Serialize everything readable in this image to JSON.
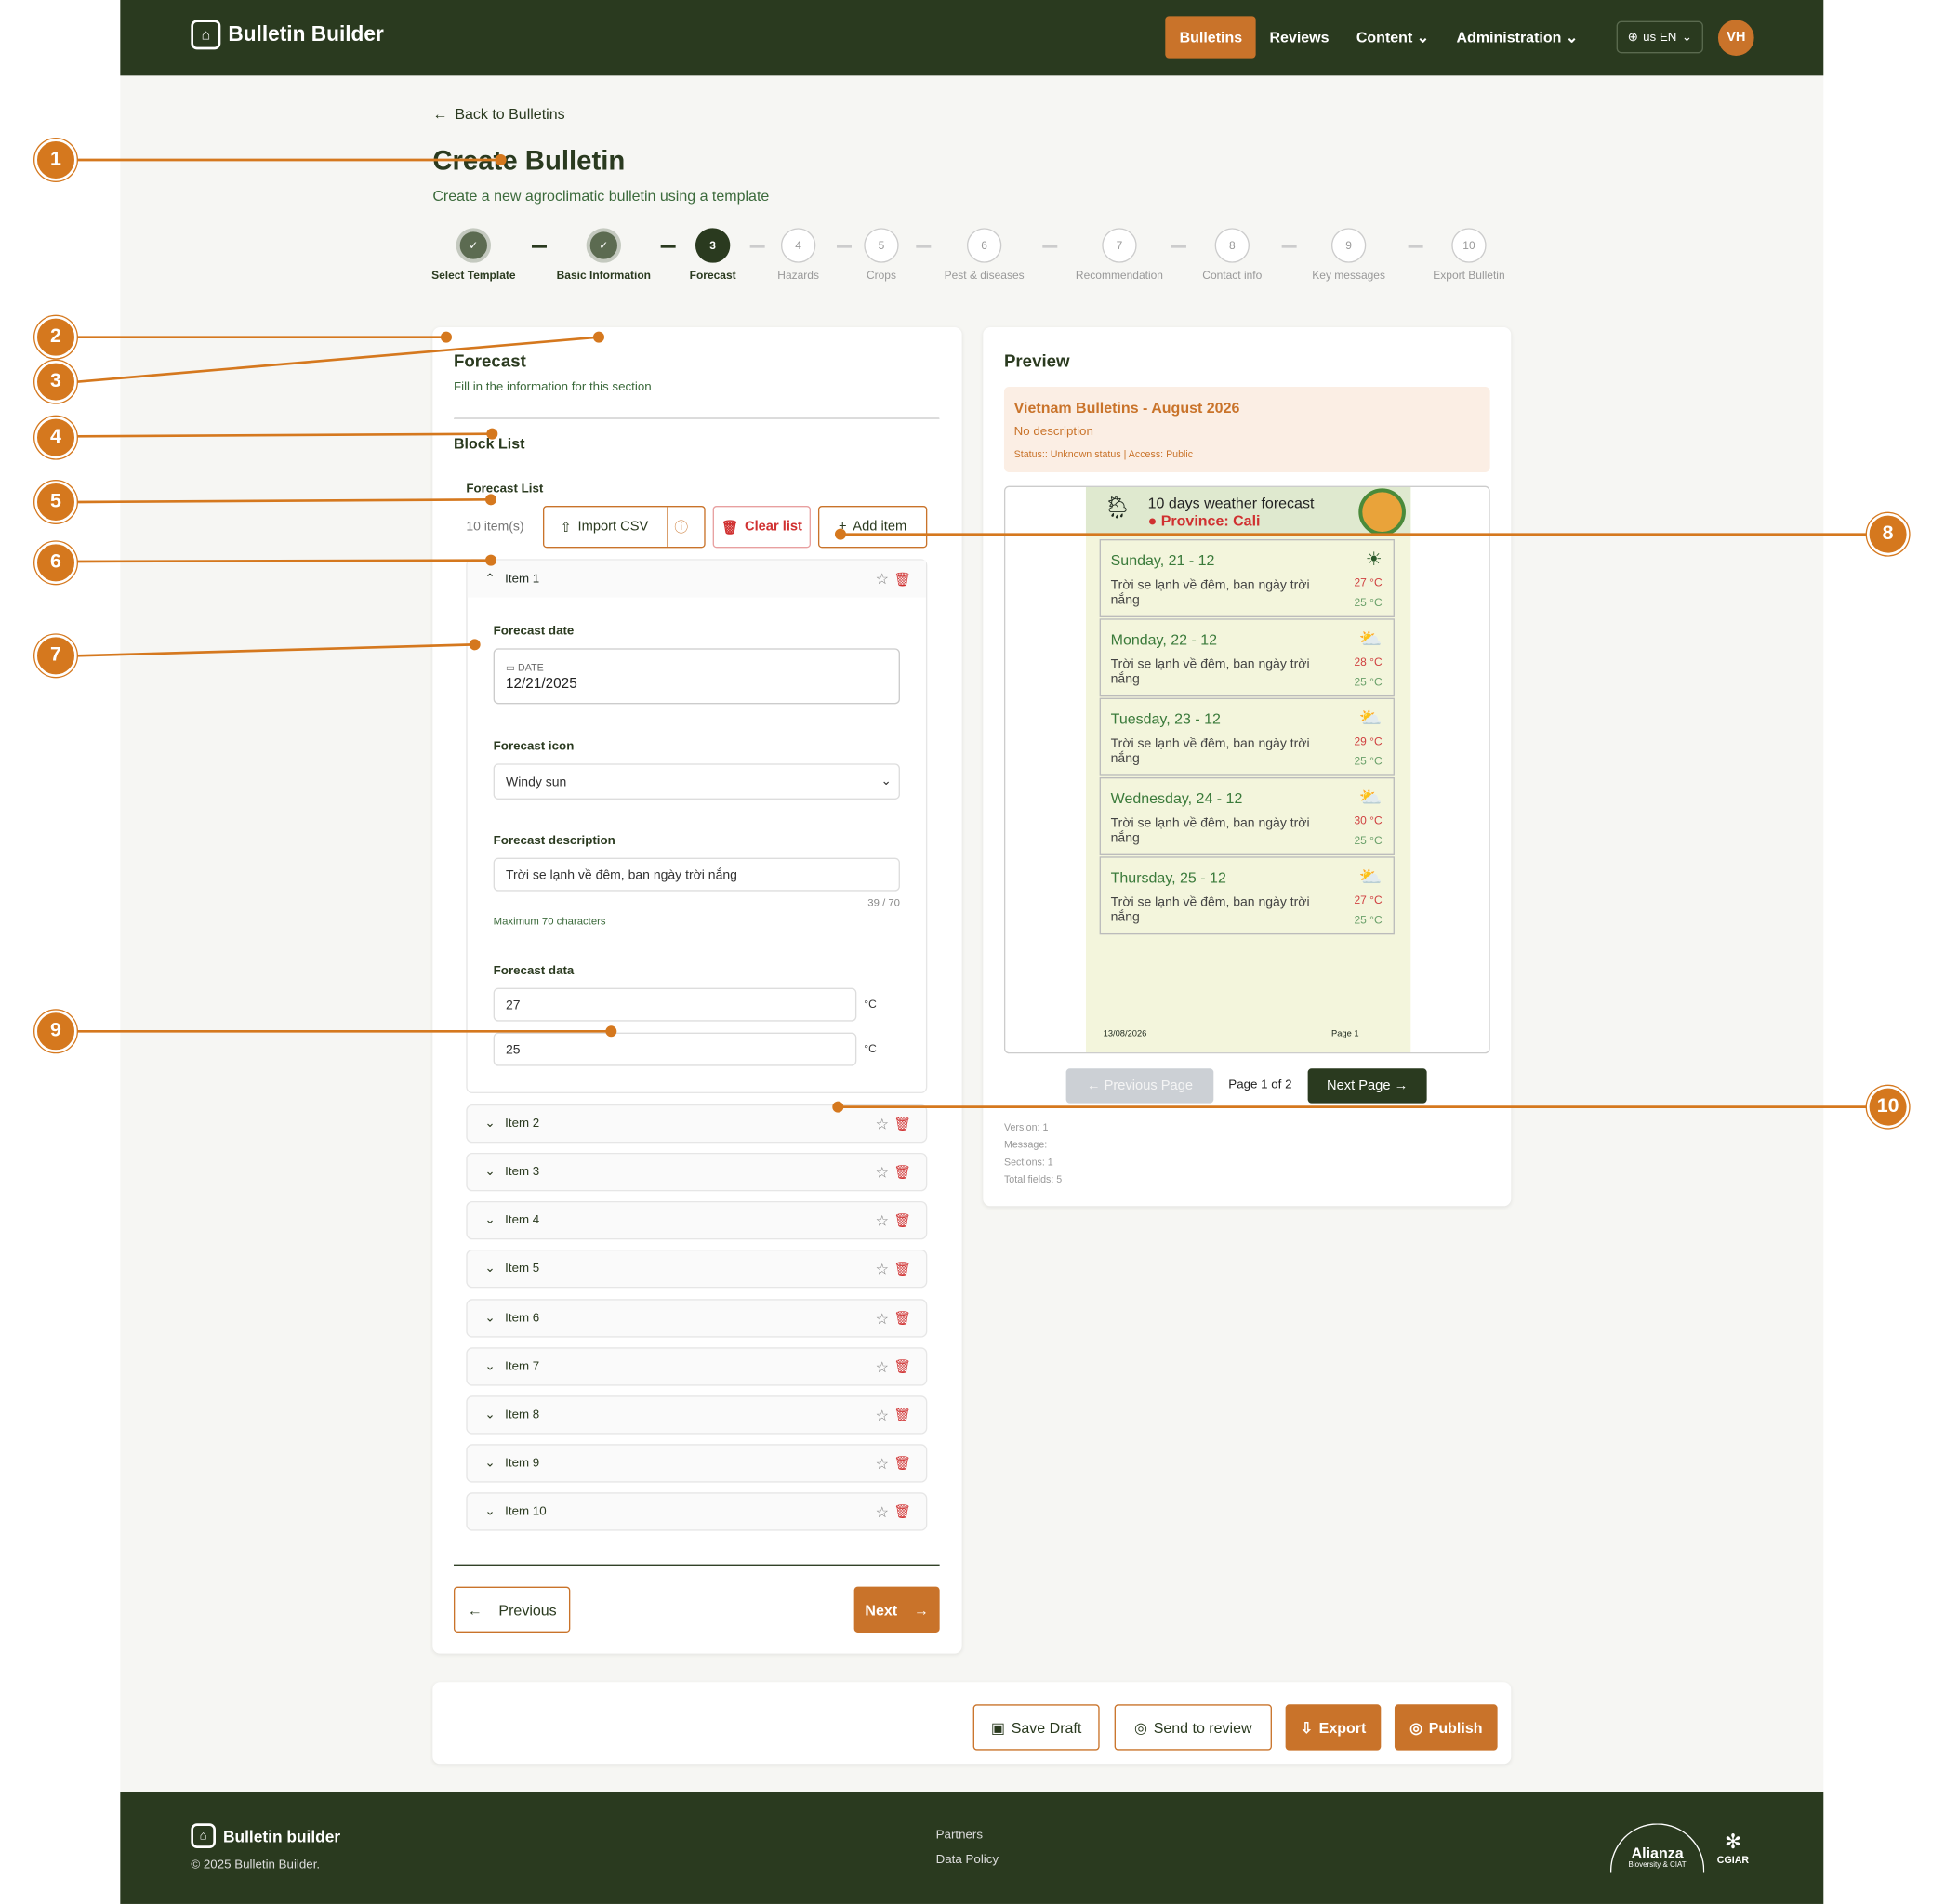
{
  "nav": {
    "brand": "Bulletin Builder",
    "links": [
      "Bulletins",
      "Reviews",
      "Content",
      "Administration"
    ],
    "lang": "us EN",
    "avatar": "VH"
  },
  "header": {
    "back": "Back to Bulletins",
    "title": "Create Bulletin",
    "subtitle": "Create a new agroclimatic bulletin using a template"
  },
  "steps": [
    {
      "num": "",
      "label": "Select Template",
      "state": "done"
    },
    {
      "num": "",
      "label": "Basic Information",
      "state": "done"
    },
    {
      "num": "3",
      "label": "Forecast",
      "state": "current"
    },
    {
      "num": "4",
      "label": "Hazards",
      "state": "todo"
    },
    {
      "num": "5",
      "label": "Crops",
      "state": "todo"
    },
    {
      "num": "6",
      "label": "Pest & diseases",
      "state": "todo"
    },
    {
      "num": "7",
      "label": "Recommendation",
      "state": "todo"
    },
    {
      "num": "8",
      "label": "Contact info",
      "state": "todo"
    },
    {
      "num": "9",
      "label": "Key messages",
      "state": "todo"
    },
    {
      "num": "10",
      "label": "Export Bulletin",
      "state": "todo"
    }
  ],
  "form": {
    "section_title": "Forecast",
    "section_hint": "Fill in the information for this section",
    "block_title": "Block List",
    "list_title": "Forecast List",
    "count": "10 item(s)",
    "import_csv": "Import CSV",
    "clear_list": "Clear list",
    "add_item": "Add item",
    "open_item": "Item 1",
    "date_label": "Forecast date",
    "date_caption": "DATE",
    "date_value": "12/21/2025",
    "icon_label": "Forecast icon",
    "icon_value": "Windy sun",
    "desc_label": "Forecast description",
    "desc_value": "Trời se lạnh về đêm, ban ngày trời nắng",
    "desc_count": "39 / 70",
    "desc_hint": "Maximum 70 characters",
    "data_label": "Forecast data",
    "temp_high": "27",
    "temp_low": "25",
    "unit": "°C",
    "items": [
      "Item 2",
      "Item 3",
      "Item 4",
      "Item 5",
      "Item 6",
      "Item 7",
      "Item 8",
      "Item 9",
      "Item 10"
    ],
    "previous": "Previous",
    "next": "Next"
  },
  "preview": {
    "title": "Preview",
    "bulletin_name": "Vietnam Bulletins - August 2026",
    "bulletin_desc": "No description",
    "bulletin_status": "Status:: Unknown status | Access: Public",
    "doc_title": "10 days weather forecast",
    "province": "Province: Cali",
    "rows": [
      {
        "day": "Sunday, 21 - 12",
        "desc": "Trời se lạnh về đêm, ban ngày trời nắng",
        "hi": "27 °C",
        "lo": "25 °C",
        "icon": "sun-icon"
      },
      {
        "day": "Monday, 22 - 12",
        "desc": "Trời se lạnh về đêm, ban ngày trời nắng",
        "hi": "28 °C",
        "lo": "25 °C",
        "icon": "partly-cloudy-icon"
      },
      {
        "day": "Tuesday, 23 - 12",
        "desc": "Trời se lạnh về đêm, ban ngày trời nắng",
        "hi": "29 °C",
        "lo": "25 °C",
        "icon": "partly-cloudy-icon"
      },
      {
        "day": "Wednesday, 24 - 12",
        "desc": "Trời se lạnh về đêm, ban ngày trời nắng",
        "hi": "30 °C",
        "lo": "25 °C",
        "icon": "partly-cloudy-icon"
      },
      {
        "day": "Thursday, 25 - 12",
        "desc": "Trời se lạnh về đêm, ban ngày trời nắng",
        "hi": "27 °C",
        "lo": "25 °C",
        "icon": "partly-cloudy-icon"
      }
    ],
    "doc_date": "13/08/2026",
    "doc_page": "Page 1",
    "prev_page": "← Previous Page",
    "page_info": "Page 1 of 2",
    "next_page": "Next Page →",
    "meta": [
      "Version: 1",
      "Message:",
      "Sections: 1",
      "Total fields: 5"
    ]
  },
  "actions": {
    "save": "Save Draft",
    "review": "Send to review",
    "export": "Export",
    "publish": "Publish"
  },
  "footer": {
    "brand": "Bulletin builder",
    "copyright": "© 2025 Bulletin Builder.",
    "links": [
      "Partners",
      "Data Policy"
    ],
    "logo1": "Alianza",
    "logo1_sub": "Bioversity & CIAT",
    "logo2": "CGIAR"
  },
  "callouts": [
    "1",
    "2",
    "3",
    "4",
    "5",
    "6",
    "7",
    "8",
    "9",
    "10"
  ],
  "colors": {
    "brand_dark": "#2a3a1f",
    "accent": "#c9732a",
    "danger": "#d03030"
  }
}
